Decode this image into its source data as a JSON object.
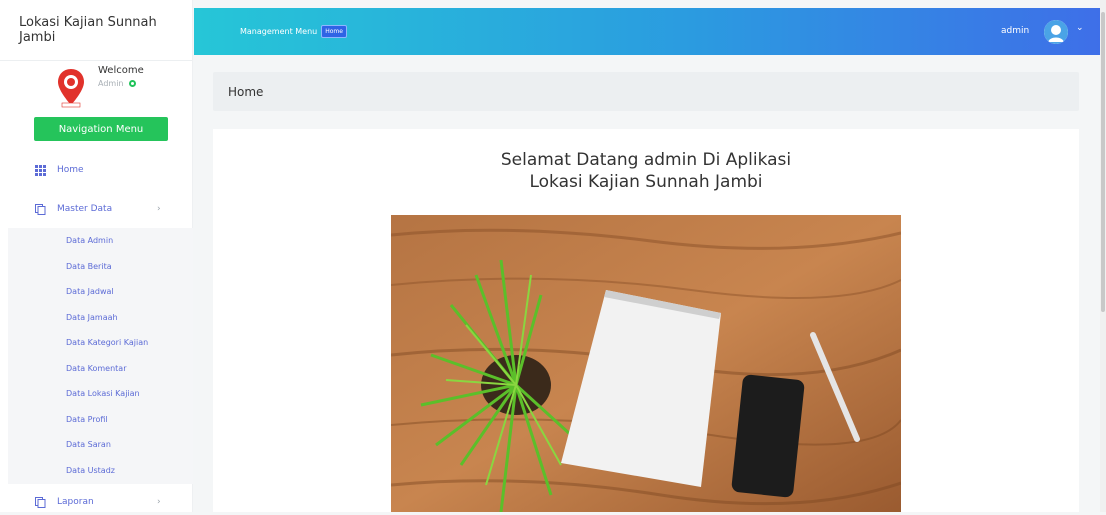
{
  "sidebar": {
    "brand": "Lokasi Kajian Sunnah Jambi",
    "welcome": "Welcome",
    "role": "Admin",
    "nav_button": "Navigation Menu",
    "items": [
      {
        "label": "Home",
        "icon": "grid-icon"
      },
      {
        "label": "Master Data",
        "icon": "copy-icon"
      },
      {
        "label": "Laporan",
        "icon": "copy-icon"
      }
    ],
    "submenu": [
      "Data Admin",
      "Data Berita",
      "Data Jadwal",
      "Data Jamaah",
      "Data Kategori Kajian",
      "Data Komentar",
      "Data Lokasi Kajian",
      "Data Profil",
      "Data Saran",
      "Data Ustadz"
    ]
  },
  "topbar": {
    "menu_label": "Management Menu",
    "badge": "Home",
    "user": "admin"
  },
  "breadcrumb": "Home",
  "main": {
    "title_line1": "Selamat Datang admin Di Aplikasi",
    "title_line2": "Lokasi Kajian Sunnah Jambi"
  },
  "colors": {
    "accent_green": "#25c45b",
    "link_blue": "#5c6bd6",
    "topbar_start": "#26c6d7",
    "topbar_end": "#3e6fe8"
  }
}
